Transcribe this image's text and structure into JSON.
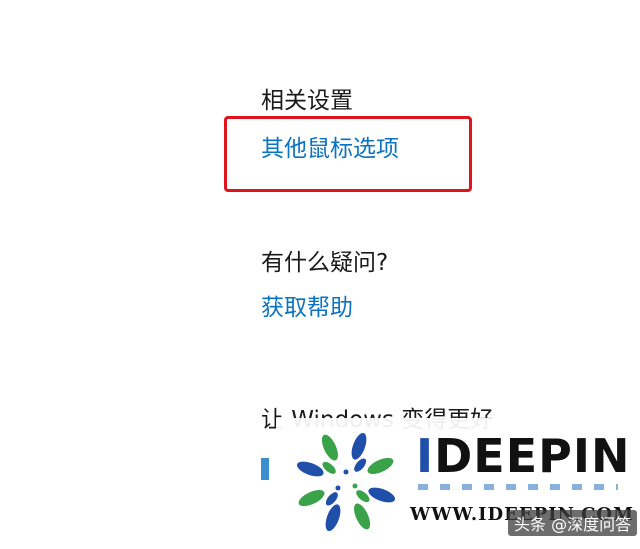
{
  "related_settings": {
    "heading": "相关设置",
    "mouse_options_link": "其他鼠标选项"
  },
  "help": {
    "heading": "有什么疑问?",
    "get_help_link": "获取帮助"
  },
  "better": {
    "heading_partial": "让 Windows 变得更好"
  },
  "watermark": {
    "brand_prefix": "I",
    "brand_rest": "DEEPIN",
    "url": "WWW.IDEEPIN.COM",
    "credit": "头条 @深度问答"
  },
  "colors": {
    "link": "#0a73c2",
    "highlight_border": "#e0141c",
    "text": "#1a1a1a",
    "logo_blue": "#1f4fa8",
    "logo_green": "#3aa34a"
  }
}
